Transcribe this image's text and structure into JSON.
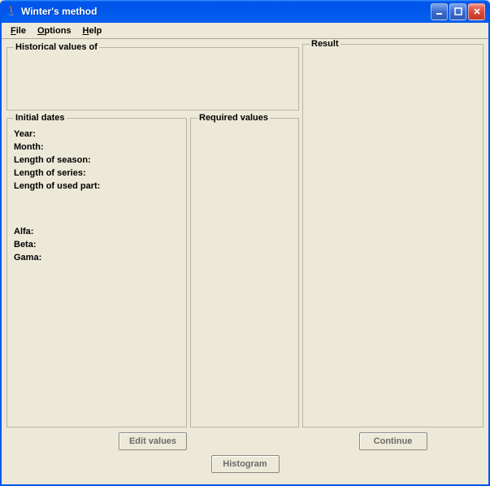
{
  "window": {
    "title": "Winter's method"
  },
  "menu": {
    "file": "File",
    "options": "Options",
    "help": "Help"
  },
  "groups": {
    "historical": "Historical values of",
    "result": "Result",
    "initial_dates": "Initial dates",
    "required_values": "Required values"
  },
  "labels": {
    "year": "Year:",
    "month": "Month:",
    "length_season": "Length of season:",
    "length_series": "Length of series:",
    "length_used_part": "Length of used part:",
    "alfa": "Alfa:",
    "beta": "Beta:",
    "gama": "Gama:"
  },
  "buttons": {
    "edit_values": "Edit values",
    "continue": "Continue",
    "histogram": "Histogram"
  }
}
